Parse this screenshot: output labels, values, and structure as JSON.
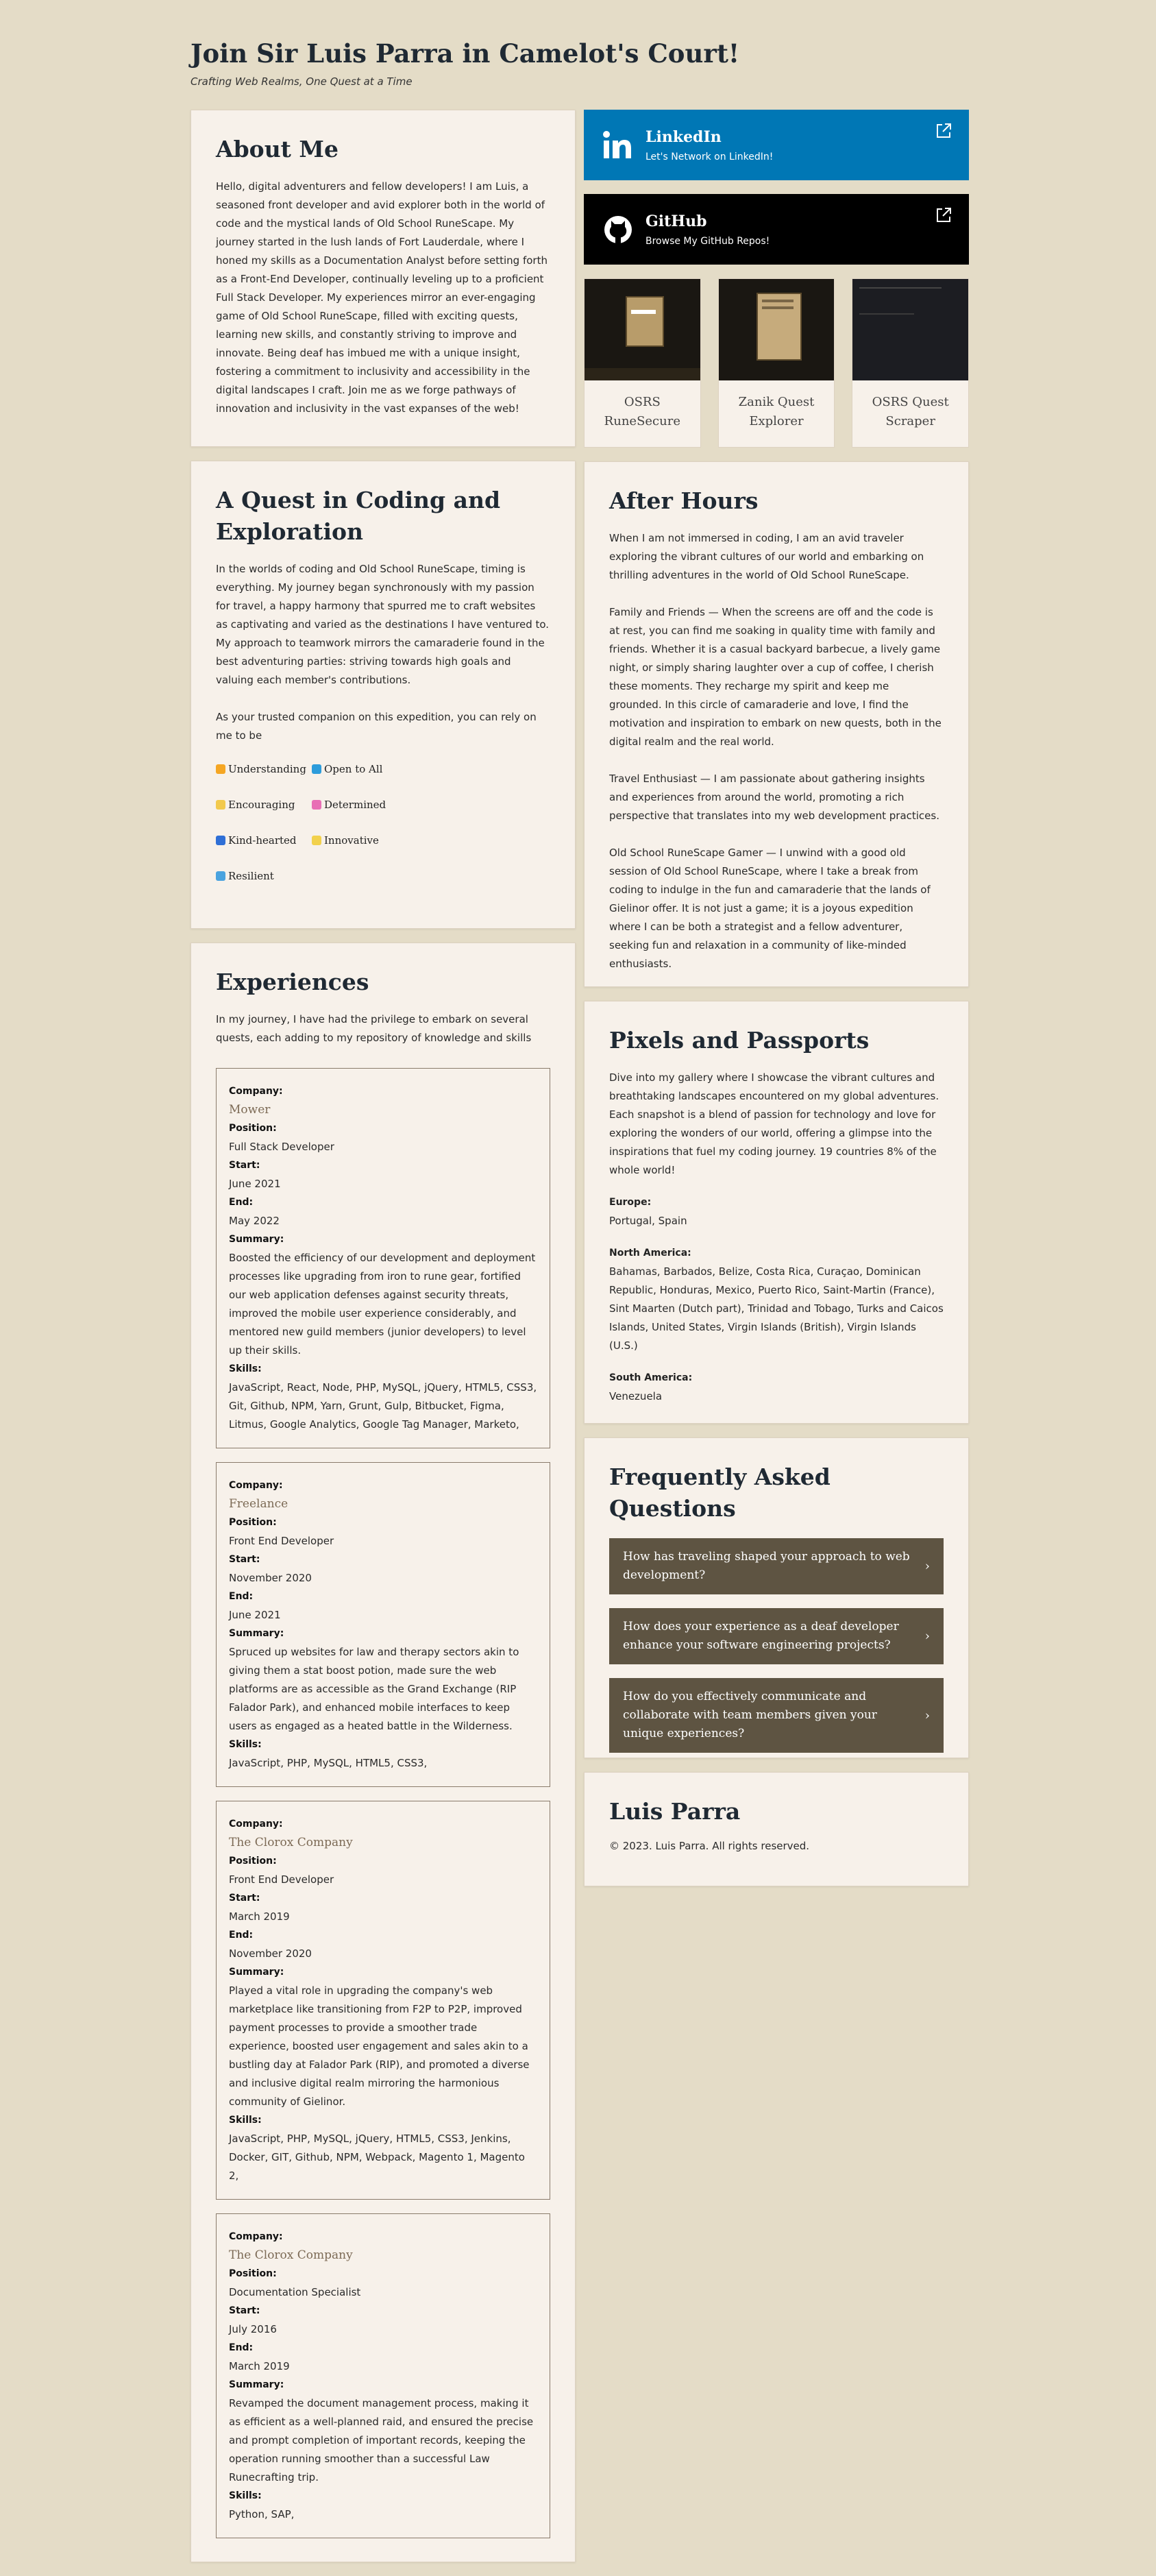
{
  "header": {
    "title": "Join Sir Luis Parra in Camelot's Court!",
    "tagline": "Crafting Web Realms, One Quest at a Time"
  },
  "about": {
    "title": "About Me",
    "text": "Hello, digital adventurers and fellow developers! I am Luis, a seasoned front developer and avid explorer both in the world of code and the mystical lands of Old School RuneScape. My journey started in the lush lands of Fort Lauderdale, where I honed my skills as a Documentation Analyst before setting forth as a Front-End Developer, continually leveling up to a proficient Full Stack Developer. My experiences mirror an ever-engaging game of Old School RuneScape, filled with exciting quests, learning new skills, and constantly striving to improve and innovate. Being deaf has imbued me with a unique insight, fostering a commitment to inclusivity and accessibility in the digital landscapes I craft. Join me as we forge pathways of innovation and inclusivity in the vast expanses of the web!"
  },
  "quest": {
    "title": "A Quest in Coding and Exploration",
    "p1": "In the worlds of coding and Old School RuneScape, timing is everything. My journey began synchronously with my passion for travel, a happy harmony that spurred me to craft websites as captivating and varied as the destinations I have ventured to. My approach to teamwork mirrors the camaraderie found in the best adventuring parties: striving towards high goals and valuing each member's contributions.",
    "p2": "As your trusted companion on this expedition, you can rely on me to be",
    "traits": [
      {
        "label": "Understanding",
        "color": "#f5a623"
      },
      {
        "label": "Open to All",
        "color": "#2d9cdb"
      },
      {
        "label": "Encouraging",
        "color": "#f2c94c"
      },
      {
        "label": "Determined",
        "color": "#e86fb5"
      },
      {
        "label": "Kind-hearted",
        "color": "#2f6fd6"
      },
      {
        "label": "Innovative",
        "color": "#f2d14c"
      },
      {
        "label": "Resilient",
        "color": "#4aa3df"
      }
    ]
  },
  "experiences": {
    "title": "Experiences",
    "intro": "In my journey, I have had the privilege to embark on several quests, each adding to my repository of knowledge and skills",
    "labels": {
      "company": "Company:",
      "position": "Position:",
      "start": "Start:",
      "end": "End:",
      "summary": "Summary:",
      "skills": "Skills:"
    },
    "items": [
      {
        "company": "Mower",
        "position": "Full Stack Developer",
        "start": "June 2021",
        "end": "May 2022",
        "summary": "Boosted the efficiency of our development and deployment processes like upgrading from iron to rune gear, fortified our web application defenses against security threats, improved the mobile user experience considerably, and mentored new guild members (junior developers) to level up their skills.",
        "skills": "JavaScript, React, Node, PHP, MySQL, jQuery, HTML5, CSS3, Git, Github, NPM, Yarn, Grunt, Gulp, Bitbucket, Figma, Litmus, Google Analytics, Google Tag Manager, Marketo,"
      },
      {
        "company": "Freelance",
        "position": "Front End Developer",
        "start": "November 2020",
        "end": "June 2021",
        "summary": "Spruced up websites for law and therapy sectors akin to giving them a stat boost potion, made sure the web platforms are as accessible as the Grand Exchange (RIP Falador Park), and enhanced mobile interfaces to keep users as engaged as a heated battle in the Wilderness.",
        "skills": "JavaScript, PHP, MySQL, HTML5, CSS3,"
      },
      {
        "company": "The Clorox Company",
        "position": "Front End Developer",
        "start": "March 2019",
        "end": "November 2020",
        "summary": "Played a vital role in upgrading the company's web marketplace like transitioning from F2P to P2P, improved payment processes to provide a smoother trade experience, boosted user engagement and sales akin to a bustling day at Falador Park (RIP), and promoted a diverse and inclusive digital realm mirroring the harmonious community of Gielinor.",
        "skills": "JavaScript, PHP, MySQL, jQuery, HTML5, CSS3, Jenkins, Docker, GIT, Github, NPM, Webpack, Magento 1, Magento 2,"
      },
      {
        "company": "The Clorox Company",
        "position": "Documentation Specialist",
        "start": "July 2016",
        "end": "March 2019",
        "summary": "Revamped the document management process, making it as efficient as a well-planned raid, and ensured the precise and prompt completion of important records, keeping the operation running smoother than a successful Law Runecrafting trip.",
        "skills": "Python, SAP,"
      }
    ]
  },
  "social": {
    "linkedin": {
      "name": "LinkedIn",
      "sub": "Let's Network on LinkedIn!",
      "color": "#0077b5"
    },
    "github": {
      "name": "GitHub",
      "sub": "Browse My GitHub Repos!",
      "color": "#000000"
    }
  },
  "projects": [
    {
      "title": "OSRS RuneSecure"
    },
    {
      "title": "Zanik Quest Explorer"
    },
    {
      "title": "OSRS Quest Scraper"
    }
  ],
  "after_hours": {
    "title": "After Hours",
    "paragraphs": [
      "When I am not immersed in coding, I am an avid traveler exploring the vibrant cultures of our world and embarking on thrilling adventures in the world of Old School RuneScape.",
      "Family and Friends — When the screens are off and the code is at rest, you can find me soaking in quality time with family and friends. Whether it is a casual backyard barbecue, a lively game night, or simply sharing laughter over a cup of coffee, I cherish these moments. They recharge my spirit and keep me grounded. In this circle of camaraderie and love, I find the motivation and inspiration to embark on new quests, both in the digital realm and the real world.",
      "Travel Enthusiast — I am passionate about gathering insights and experiences from around the world, promoting a rich perspective that translates into my web development practices.",
      "Old School RuneScape Gamer — I unwind with a good old session of Old School RuneScape, where I take a break from coding to indulge in the fun and camaraderie that the lands of Gielinor offer. It is not just a game; it is a joyous expedition where I can be both a strategist and a fellow adventurer, seeking fun and relaxation in a community of like-minded enthusiasts."
    ]
  },
  "pixels": {
    "title": "Pixels and Passports",
    "intro": "Dive into my gallery where I showcase the vibrant cultures and breathtaking landscapes encountered on my global adventures. Each snapshot is a blend of passion for technology and love for exploring the wonders of our world, offering a glimpse into the inspirations that fuel my coding journey. 19 countries 8% of the whole world!",
    "regions": [
      {
        "label": "Europe:",
        "countries": "Portugal, Spain"
      },
      {
        "label": "North America:",
        "countries": "Bahamas, Barbados, Belize, Costa Rica, Curaçao, Dominican Republic, Honduras, Mexico, Puerto Rico, Saint-Martin (France), Sint Maarten (Dutch part), Trinidad and Tobago, Turks and Caicos Islands, United States, Virgin Islands (British), Virgin Islands (U.S.)"
      },
      {
        "label": "South America:",
        "countries": "Venezuela"
      }
    ]
  },
  "faq": {
    "title": "Frequently Asked Questions",
    "items": [
      {
        "q": "How has traveling shaped your approach to web development?"
      },
      {
        "q": "How does your experience as a deaf developer enhance your software engineering projects?"
      },
      {
        "q": "How do you effectively communicate and collaborate with team members given your unique experiences?"
      }
    ]
  },
  "footer": {
    "name": "Luis Parra",
    "copyright": "© 2023. Luis Parra. All rights reserved."
  }
}
